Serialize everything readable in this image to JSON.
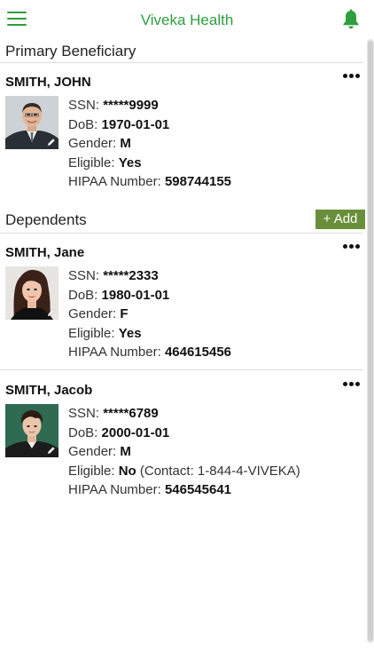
{
  "header": {
    "title": "Viveka Health",
    "menu_icon": "hamburger-icon",
    "notify_icon": "bell-icon"
  },
  "primary": {
    "section_title": "Primary Beneficiary",
    "member": {
      "name": "SMITH, JOHN",
      "ssn_label": "SSN:",
      "ssn": "*****9999",
      "dob_label": "DoB:",
      "dob": "1970-01-01",
      "gender_label": "Gender:",
      "gender": "M",
      "eligible_label": "Eligible:",
      "eligible": "Yes",
      "hipaa_label": "HIPAA Number:",
      "hipaa": "598744155"
    }
  },
  "dependents": {
    "section_title": "Dependents",
    "add_label": "+ Add",
    "members": [
      {
        "name": "SMITH, Jane",
        "ssn_label": "SSN:",
        "ssn": "*****2333",
        "dob_label": "DoB:",
        "dob": "1980-01-01",
        "gender_label": "Gender:",
        "gender": "F",
        "eligible_label": "Eligible:",
        "eligible": "Yes",
        "hipaa_label": "HIPAA Number:",
        "hipaa": "464615456"
      },
      {
        "name": "SMITH, Jacob",
        "ssn_label": "SSN:",
        "ssn": "*****6789",
        "dob_label": "DoB:",
        "dob": "2000-01-01",
        "gender_label": "Gender:",
        "gender": "M",
        "eligible_label": "Eligible:",
        "eligible": "No",
        "eligible_note": "(Contact: 1-844-4-VIVEKA)",
        "hipaa_label": "HIPAA Number:",
        "hipaa": "546545641"
      }
    ]
  },
  "colors": {
    "brand_green": "#2e9e3f",
    "add_button": "#6a8f3a"
  }
}
